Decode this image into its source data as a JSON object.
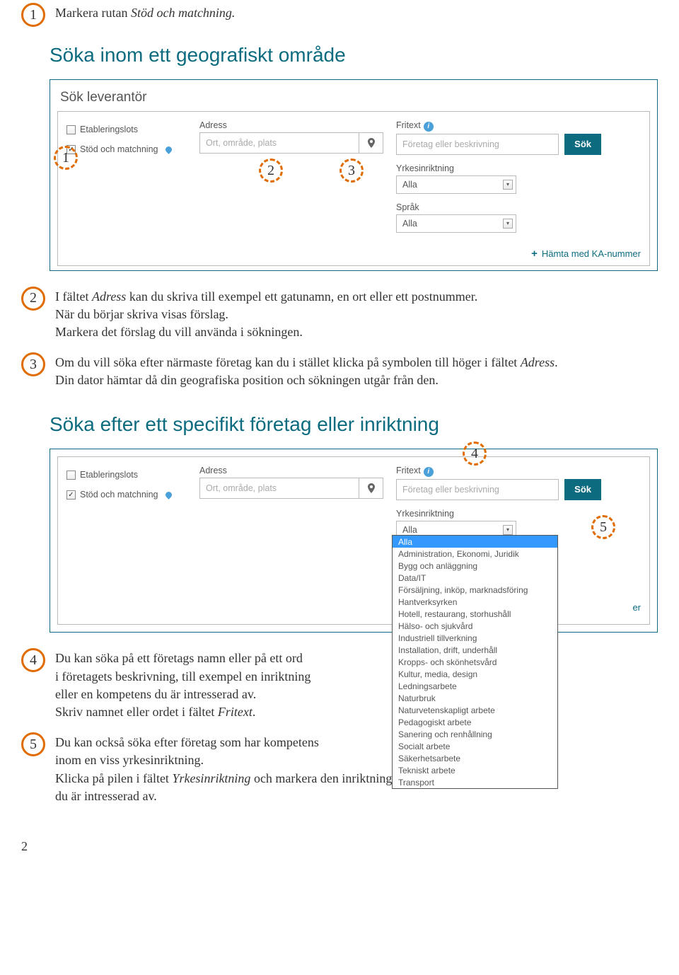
{
  "step1": {
    "num": "1",
    "text_pre": "Markera rutan ",
    "text_italic": "Stöd och matchning."
  },
  "heading_a": "Söka inom ett geografiskt område",
  "panel1": {
    "title": "Sök leverantör",
    "etableringslots": "Etableringslots",
    "stod": "Stöd och matchning",
    "adress_label": "Adress",
    "adress_ph": "Ort, område, plats",
    "fritext_label": "Fritext",
    "fritext_ph": "Företag eller beskrivning",
    "sok": "Sök",
    "yrke_label": "Yrkesinriktning",
    "alla": "Alla",
    "sprak_label": "Språk",
    "ka": "Hämta med KA-nummer",
    "m1": "1",
    "m2": "2",
    "m3": "3"
  },
  "step2": {
    "num": "2",
    "l1a": "I fältet ",
    "l1i": "Adress",
    "l1b": " kan du skriva till exempel ett gatunamn, en ort eller ett postnummer.",
    "l2": "När du börjar skriva visas förslag.",
    "l3": "Markera det förslag du vill använda i sökningen."
  },
  "step3": {
    "num": "3",
    "l1a": "Om du vill söka efter närmaste företag kan du i stället klicka på symbolen till höger i fältet ",
    "l1i": "Adress",
    "l1b": ".",
    "l2": "Din dator hämtar då din geografiska position och sökningen utgår från den."
  },
  "heading_b": "Söka efter ett specifikt företag eller inriktning",
  "panel2": {
    "m4": "4",
    "m5": "5",
    "suffix": "er",
    "dd": [
      "Alla",
      "Administration, Ekonomi, Juridik",
      "Bygg och anläggning",
      "Data/IT",
      "Försäljning, inköp, marknadsföring",
      "Hantverksyrken",
      "Hotell, restaurang, storhushåll",
      "Hälso- och sjukvård",
      "Industriell tillverkning",
      "Installation, drift, underhåll",
      "Kropps- och skönhetsvård",
      "Kultur, media, design",
      "Ledningsarbete",
      "Naturbruk",
      "Naturvetenskapligt arbete",
      "Pedagogiskt arbete",
      "Sanering och renhållning",
      "Socialt arbete",
      "Säkerhetsarbete",
      "Tekniskt arbete",
      "Transport"
    ]
  },
  "step4": {
    "num": "4",
    "l1": "Du kan söka på ett företags namn eller på ett ord",
    "l2": "i företagets beskrivning, till exempel en inriktning",
    "l3": "eller en kompetens du är intresserad av.",
    "l4a": "Skriv namnet eller ordet i fältet ",
    "l4i": "Fritext",
    "l4b": "."
  },
  "step5": {
    "num": "5",
    "l1": "Du kan också söka efter företag som har kompetens",
    "l2": "inom en viss yrkesinriktning.",
    "l3a": "Klicka på pilen i fältet ",
    "l3i": "Yrkesinriktning",
    "l3b": " och markera den inriktning du är intresserad av."
  },
  "page": "2"
}
